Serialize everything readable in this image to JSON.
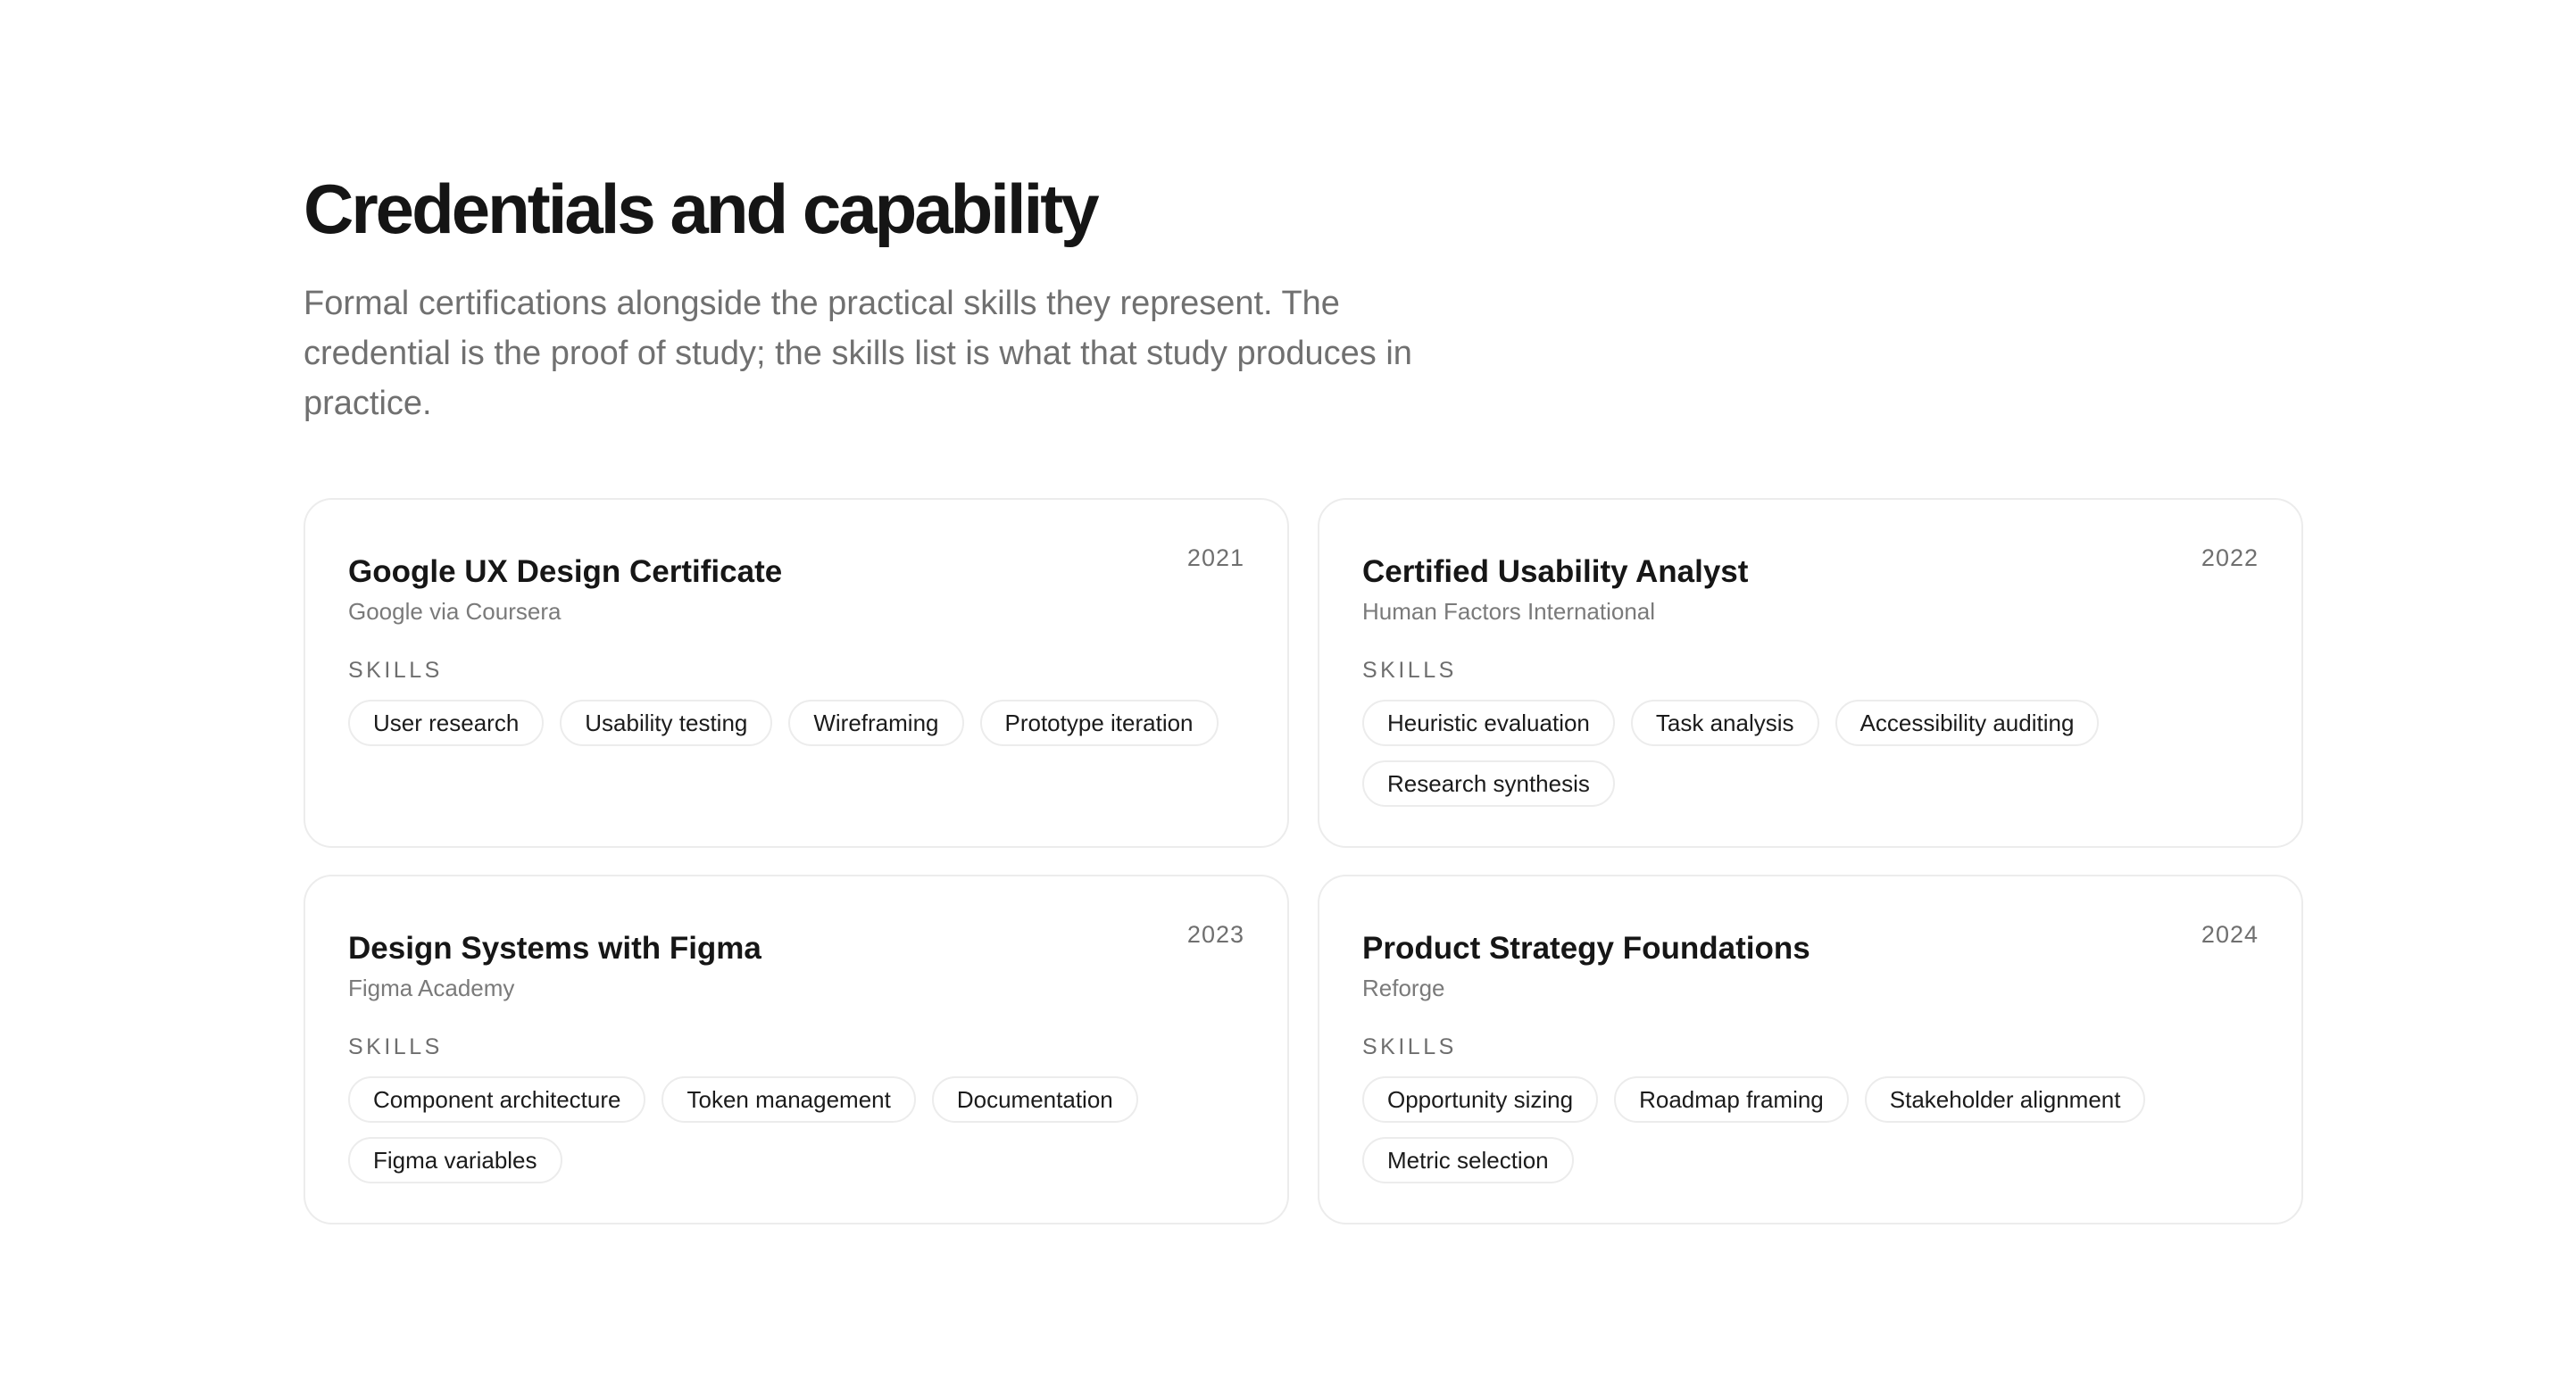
{
  "header": {
    "title": "Credentials and capability",
    "description": "Formal certifications alongside the practical skills they represent. The credential is the proof of study; the skills list is what that study produces in practice."
  },
  "skills_label": "SKILLS",
  "credentials": [
    {
      "title": "Google UX Design Certificate",
      "issuer": "Google via Coursera",
      "year": "2021",
      "skills": [
        "User research",
        "Usability testing",
        "Wireframing",
        "Prototype iteration"
      ]
    },
    {
      "title": "Certified Usability Analyst",
      "issuer": "Human Factors International",
      "year": "2022",
      "skills": [
        "Heuristic evaluation",
        "Task analysis",
        "Accessibility auditing",
        "Research synthesis"
      ]
    },
    {
      "title": "Design Systems with Figma",
      "issuer": "Figma Academy",
      "year": "2023",
      "skills": [
        "Component architecture",
        "Token management",
        "Documentation",
        "Figma variables"
      ]
    },
    {
      "title": "Product Strategy Foundations",
      "issuer": "Reforge",
      "year": "2024",
      "skills": [
        "Opportunity sizing",
        "Roadmap framing",
        "Stakeholder alignment",
        "Metric selection"
      ]
    }
  ]
}
